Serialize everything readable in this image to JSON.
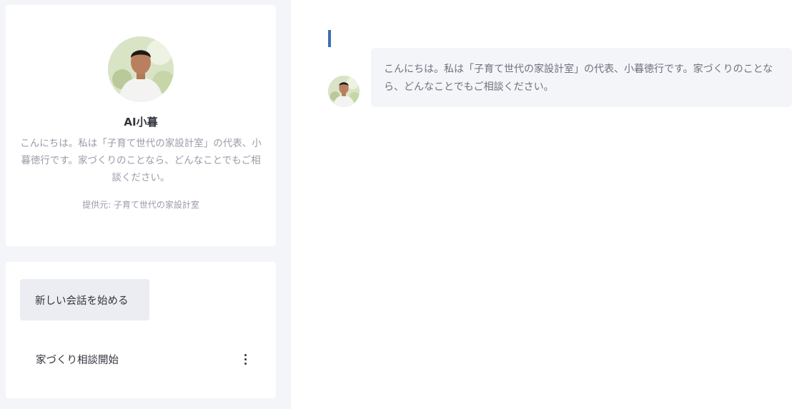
{
  "profile": {
    "name": "AI小暮",
    "description": "こんにちは。私は「子育て世代の家設計室」の代表、小暮徳行です。家づくりのことなら、どんなことでもご相談ください。",
    "source": "提供元: 子育て世代の家設計室"
  },
  "conversations": {
    "new_chat_label": "新しい会話を始める",
    "items": [
      {
        "title": "家づくり相談開始"
      }
    ]
  },
  "chat": {
    "messages": [
      {
        "role": "assistant",
        "text": "こんにちは。私は「子育て世代の家設計室」の代表、小暮徳行です。家づくりのことなら、どんなことでもご相談ください。"
      }
    ]
  },
  "colors": {
    "sidebar_bg": "#f4f5f9",
    "button_bg": "#ecedf3",
    "bubble_bg": "#f4f5f9",
    "accent": "#3f6db6",
    "text_primary": "#33353d",
    "text_muted": "#9a9ca8"
  },
  "icons": {
    "profile_avatar": "avatar-photo",
    "message_avatar": "avatar-photo",
    "conversation_menu": "more-vertical-icon"
  }
}
